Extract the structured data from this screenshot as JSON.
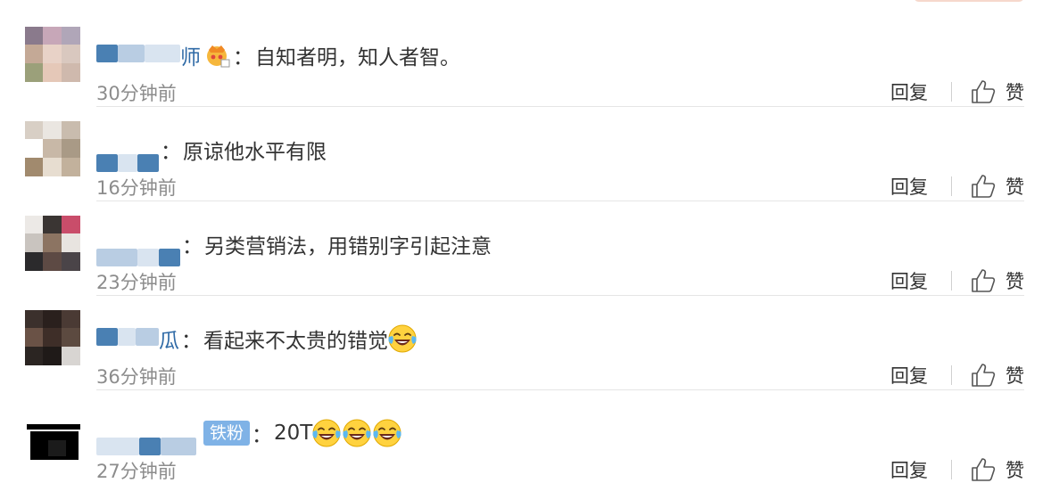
{
  "ui": {
    "separator": "：",
    "reply_label": "回复",
    "like_label": "赞",
    "emoji_name": "laughing-crying-emoji"
  },
  "colors": {
    "username": "#2f6aa6",
    "timestamp": "#8c8c8c",
    "body_text": "#333333",
    "iron_fan_badge": "#7fb2e6"
  },
  "comments": [
    {
      "username": "师",
      "has_vip_badge": true,
      "text": "自知者明，知人者智。",
      "emoji_count": 0,
      "time": "30分钟前"
    },
    {
      "username": "",
      "text": "原谅他水平有限",
      "emoji_count": 0,
      "time": "16分钟前"
    },
    {
      "username": "",
      "text": "另类营销法，用错别字引起注意",
      "emoji_count": 0,
      "time": "23分钟前"
    },
    {
      "username": "瓜",
      "text": "看起来不太贵的错觉",
      "emoji_count": 1,
      "time": "36分钟前"
    },
    {
      "username": "",
      "badge": "铁粉",
      "text": "20T",
      "emoji_count": 3,
      "time": "27分钟前"
    }
  ]
}
